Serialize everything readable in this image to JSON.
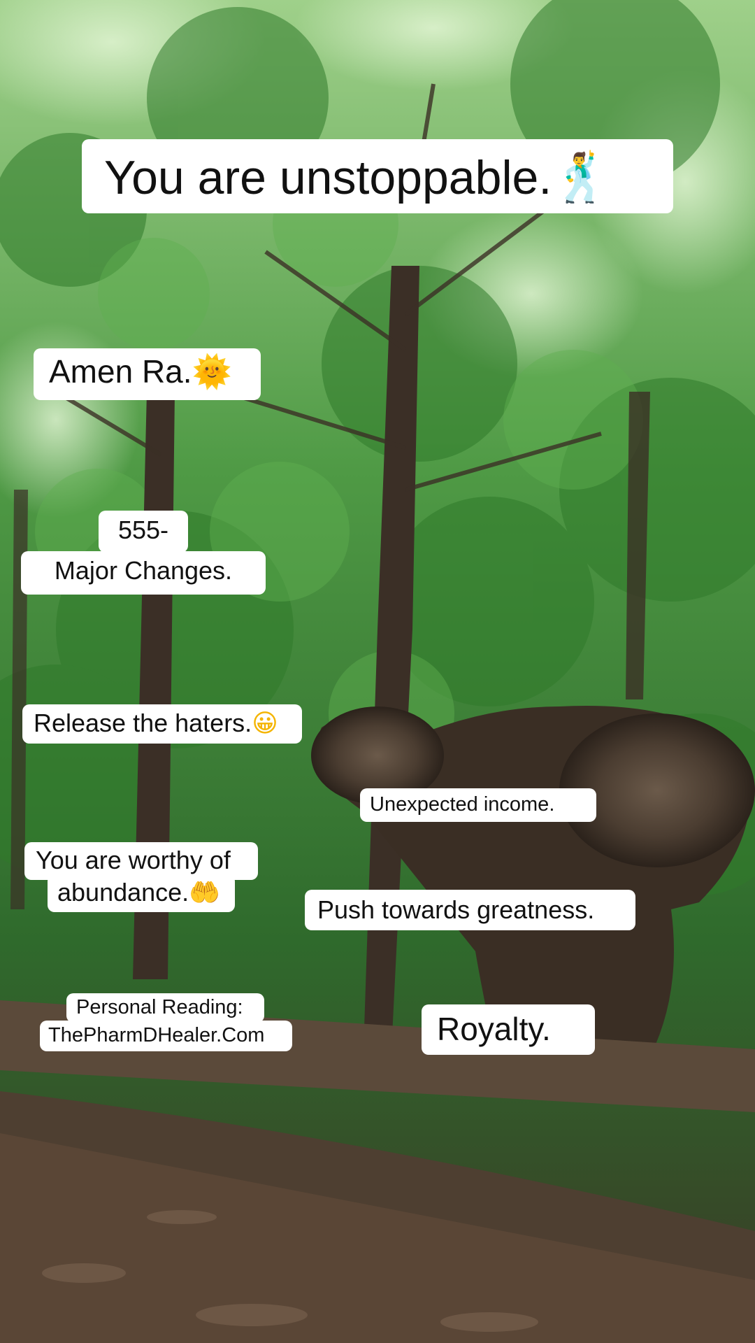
{
  "captions": {
    "headline": {
      "text": "You are unstoppable.",
      "emoji": "🕺"
    },
    "amen": {
      "text": "Amen Ra.",
      "emoji": "🌞"
    },
    "number_top": "555-",
    "number_bottom": "Major Changes.",
    "release": {
      "text": "Release the haters.",
      "emoji": "😀"
    },
    "income": "Unexpected income.",
    "worthy_line1": "You are worthy of",
    "worthy_line2": {
      "text": "abundance.",
      "emoji": "🤲"
    },
    "greatness": "Push towards greatness.",
    "reading_line1": "Personal Reading:",
    "reading_line2": "ThePharmDHealer.Com",
    "royalty": "Royalty."
  },
  "colors": {
    "caption_bg": "#ffffff",
    "caption_text": "#111111",
    "foliage": "#3f7a3a",
    "trunk": "#3b2f26",
    "forest_floor": "#5a4636"
  }
}
